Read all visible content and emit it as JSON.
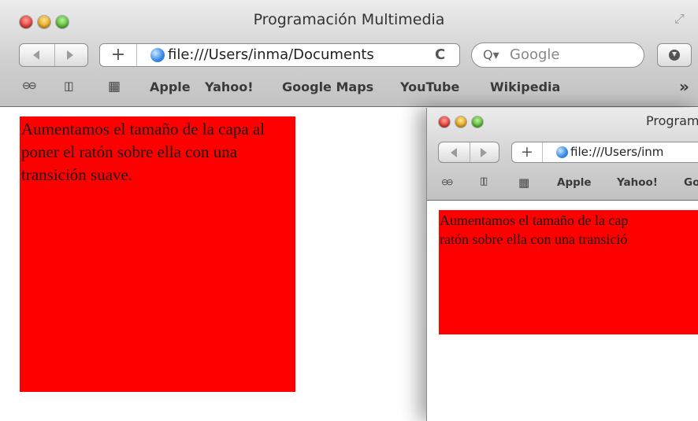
{
  "back_window": {
    "title": "Programación Multimedia",
    "url": "file:///Users/inma/Documents",
    "search_placeholder": "Google",
    "bookmarks": [
      "Apple",
      "Yahoo!",
      "Google Maps",
      "YouTube",
      "Wikipedia"
    ],
    "overflow": "»",
    "layer_text": "Aumentamos el tamaño de la capa al poner el ratón sobre ella con una transición suave."
  },
  "front_window": {
    "title": "Program",
    "url": "file:///Users/inm",
    "bookmarks": [
      "Apple",
      "Yahoo!",
      "Go"
    ],
    "layer_line1": "Aumentamos el tamaño de la cap",
    "layer_line2": "ratón sobre ella con una transició"
  },
  "icons": {
    "reading_list": "⊖⊖",
    "bookmarks_book": "▯▯",
    "top_sites": "▦",
    "reload": "C",
    "resize": "⤢",
    "plus": "+",
    "search_glass": "Q▾"
  },
  "colors": {
    "layer": "#ff0000",
    "chrome_top": "#ececec",
    "chrome_bottom": "#c2c2c2"
  }
}
